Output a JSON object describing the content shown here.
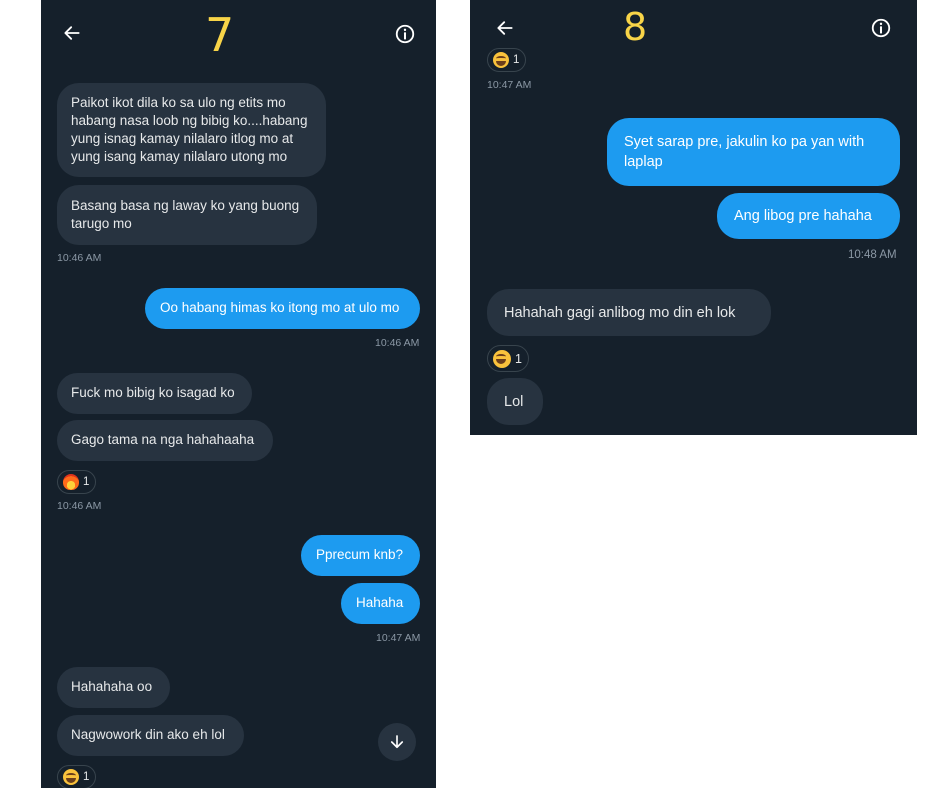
{
  "screen7": {
    "number": "7",
    "messages": [
      {
        "dir": "received",
        "text": "Paikot ikot dila ko sa ulo ng etits mo habang nasa loob ng bibig ko....habang yung isnag kamay nilalaro itlog mo at yung isang kamay nilalaro utong mo"
      },
      {
        "dir": "received",
        "text": "Basang basa ng laway ko yang buong tarugo mo"
      },
      {
        "dir": "sent",
        "text": "Oo habang himas ko itong mo at ulo mo"
      },
      {
        "dir": "received",
        "text": "Fuck mo bibig ko isagad ko"
      },
      {
        "dir": "received",
        "text": "Gago tama na nga hahahaaha"
      },
      {
        "dir": "sent",
        "text": "Pprecum knb?"
      },
      {
        "dir": "sent",
        "text": "Hahaha"
      },
      {
        "dir": "received",
        "text": "Hahahaha oo"
      },
      {
        "dir": "received",
        "text": "Nagwowork din ako eh lol"
      }
    ],
    "timestamps": [
      "10:46 AM",
      "10:46 AM",
      "10:46 AM",
      "10:47 AM"
    ],
    "reactions": [
      {
        "emoji": "fire",
        "count": "1"
      },
      {
        "emoji": "laughing-face",
        "count": "1"
      }
    ]
  },
  "screen8": {
    "number": "8",
    "reactions": [
      {
        "emoji": "laughing-face",
        "count": "1"
      },
      {
        "emoji": "laughing-face",
        "count": "1"
      }
    ],
    "timestamps": [
      "10:47 AM",
      "10:48 AM"
    ],
    "messages": [
      {
        "dir": "sent",
        "text": "Syet sarap pre, jakulin ko pa yan with laplap"
      },
      {
        "dir": "sent",
        "text": "Ang libog pre hahaha"
      },
      {
        "dir": "received",
        "text": "Hahahah gagi anlibog mo din eh lok"
      },
      {
        "dir": "received",
        "text": "Lol"
      }
    ]
  },
  "icons": [
    "back-arrow-icon",
    "info-icon",
    "scroll-down-arrow-icon"
  ],
  "colors": {
    "background": "#15202b",
    "sent_bubble": "#1d9bf0",
    "received_bubble": "#273340",
    "timestamp": "#8b98a5",
    "overlay_number": "#f8d448"
  }
}
